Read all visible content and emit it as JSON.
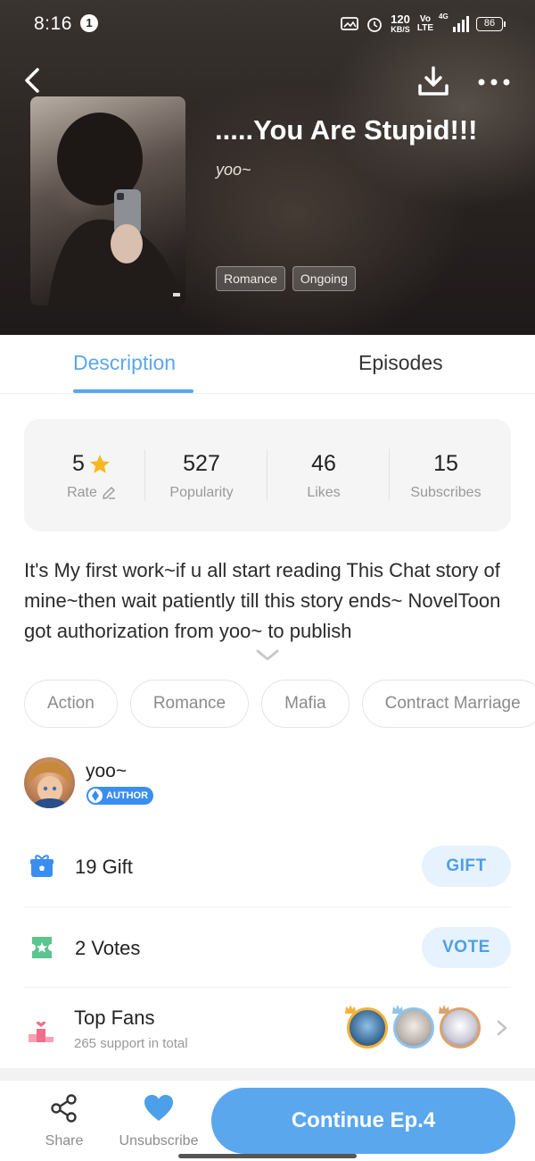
{
  "status_bar": {
    "time": "8:16",
    "notification_count": "1",
    "net_speed_top": "120",
    "net_speed_unit": "KB/S",
    "volte_top": "Vo",
    "volte_bottom": "LTE",
    "network": "4G",
    "battery": "86"
  },
  "book": {
    "title": ".....You Are Stupid!!!",
    "author": "yoo~",
    "genres": [
      "Romance",
      "Ongoing"
    ]
  },
  "tabs": [
    {
      "label": "Description",
      "active": true
    },
    {
      "label": "Episodes",
      "active": false
    }
  ],
  "stats": [
    {
      "value": "5",
      "label": "Rate"
    },
    {
      "value": "527",
      "label": "Popularity"
    },
    {
      "value": "46",
      "label": "Likes"
    },
    {
      "value": "15",
      "label": "Subscribes"
    }
  ],
  "description": "It's My first work~if u all start reading This Chat story of mine~then wait patiently till this story ends~ NovelToon got authorization from yoo~ to publish",
  "tags": [
    "Action",
    "Romance",
    "Mafia",
    "Contract Marriage"
  ],
  "author": {
    "name": "yoo~",
    "badge": "AUTHOR"
  },
  "gift": {
    "label": "19 Gift",
    "button": "GIFT"
  },
  "votes": {
    "label": "2 Votes",
    "button": "VOTE"
  },
  "top_fans": {
    "title": "Top Fans",
    "subtitle": "265 support in total"
  },
  "bottom_bar": {
    "share": "Share",
    "unsubscribe": "Unsubscribe",
    "continue": "Continue Ep.4"
  },
  "colors": {
    "accent": "#5aa7ee",
    "star": "#f5b820",
    "gift_icon": "#3a8ef0",
    "vote_icon": "#5bc48f",
    "fans_icon": "#f06e8a"
  }
}
